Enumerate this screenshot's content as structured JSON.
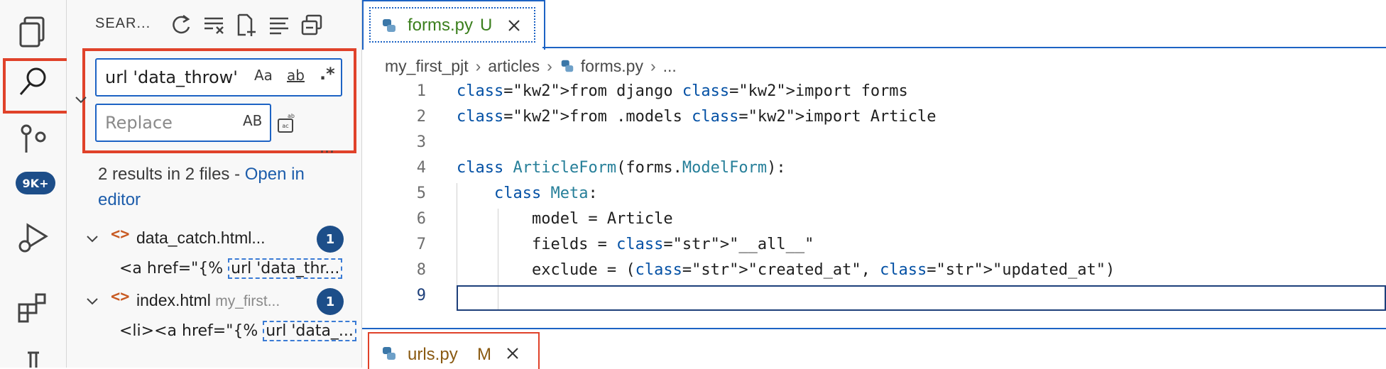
{
  "sidebar": {
    "title": "SEAR...",
    "search": {
      "value": "url 'data_throw'",
      "options": [
        "Aa",
        "ab",
        ".*"
      ]
    },
    "replace": {
      "placeholder": "Replace",
      "option": "AB"
    },
    "more": "...",
    "summary": {
      "text": "2 results in 2 files - ",
      "link": "Open in editor"
    },
    "results": [
      {
        "file": "data_catch.html...",
        "path": "",
        "count": "1",
        "match_prefix": "<a href=\"{% ",
        "match_hit": "url 'data_thr..."
      },
      {
        "file": "index.html",
        "path": "my_first...",
        "count": "1",
        "match_prefix": "<li><a href=\"{% ",
        "match_hit": "url 'data_..."
      }
    ]
  },
  "activity": {
    "badge": "9K+"
  },
  "editor": {
    "tabs": [
      {
        "label": "forms.py",
        "status": "U"
      },
      {
        "label": "urls.py",
        "status": "M"
      }
    ],
    "breadcrumb": [
      "my_first_pjt",
      "articles",
      "forms.py",
      "..."
    ],
    "lines": [
      {
        "n": "1",
        "code": "from django import forms"
      },
      {
        "n": "2",
        "code": "from .models import Article"
      },
      {
        "n": "3",
        "code": ""
      },
      {
        "n": "4",
        "code": "class ArticleForm(forms.ModelForm):"
      },
      {
        "n": "5",
        "code": "    class Meta:"
      },
      {
        "n": "6",
        "code": "        model = Article"
      },
      {
        "n": "7",
        "code": "        fields = \"__all__\""
      },
      {
        "n": "8",
        "code": "        exclude = (\"created_at\", \"updated_at\")"
      },
      {
        "n": "9",
        "code": ""
      }
    ]
  },
  "colors": {
    "accent": "#1d63c4",
    "highlight": "#e0422a",
    "badge": "#1d4e89"
  }
}
